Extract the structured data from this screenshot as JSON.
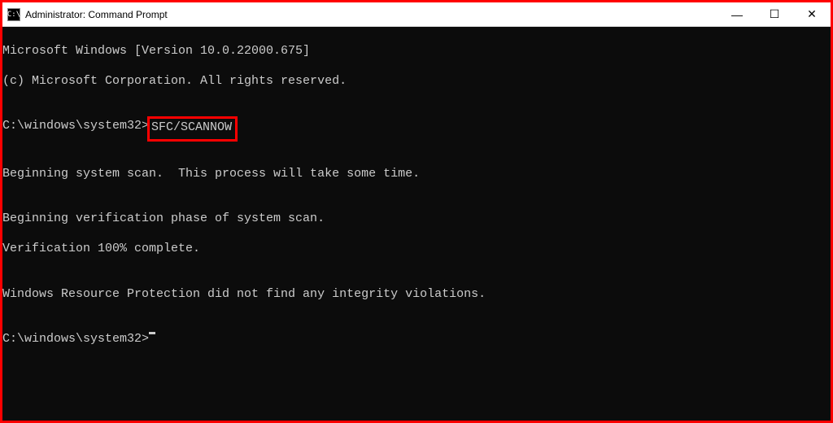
{
  "titlebar": {
    "icon_text": "C:\\",
    "title": "Administrator: Command Prompt"
  },
  "controls": {
    "minimize": "—",
    "maximize": "☐",
    "close": "✕"
  },
  "terminal": {
    "line1": "Microsoft Windows [Version 10.0.22000.675]",
    "line2": "(c) Microsoft Corporation. All rights reserved.",
    "blank": "",
    "prompt1_prefix": "C:\\windows\\system32>",
    "prompt1_command": "SFC/SCANNOW",
    "line_scan": "Beginning system scan.  This process will take some time.",
    "line_verif": "Beginning verification phase of system scan.",
    "line_complete": "Verification 100% complete.",
    "line_result": "Windows Resource Protection did not find any integrity violations.",
    "prompt2": "C:\\windows\\system32>"
  }
}
